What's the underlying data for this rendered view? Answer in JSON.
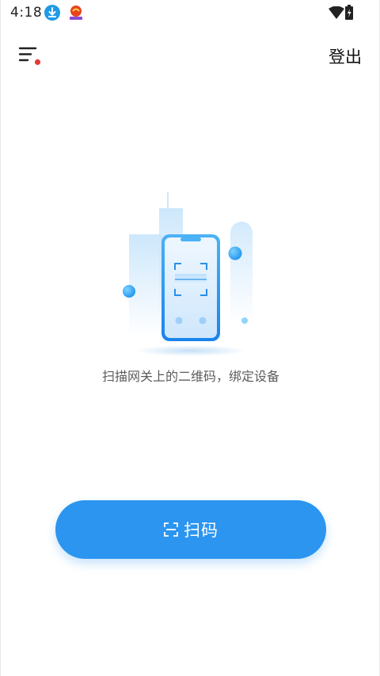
{
  "status_bar": {
    "time": "4:18",
    "icons": [
      "download-icon",
      "app-notification-icon",
      "wifi-icon",
      "battery-charging-icon"
    ]
  },
  "header": {
    "menu_icon": "menu-icon",
    "notification_dot_color": "#e53935",
    "logout_label": "登出"
  },
  "main": {
    "illustration": "phone-scan-illustration",
    "caption": "扫描网关上的二维码，绑定设备"
  },
  "scan_button": {
    "icon": "scan-icon",
    "label": "扫码",
    "color": "#2b95f0"
  }
}
